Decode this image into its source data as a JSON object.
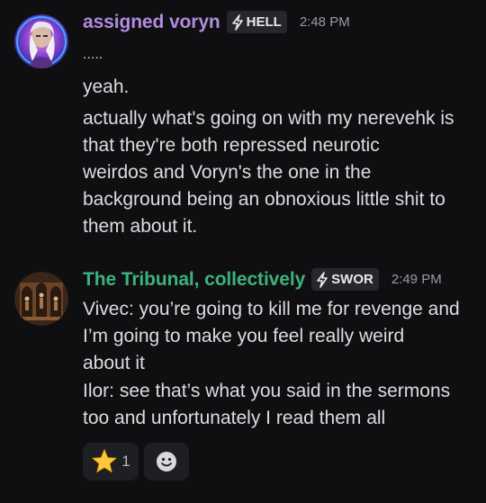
{
  "colors": {
    "background": "#0f0f11",
    "message_text": "#dcdde0",
    "timestamp": "#9a9ca3",
    "tag_background": "#26272c",
    "reaction_background": "#1e1f23"
  },
  "messages": [
    {
      "username": "assigned voryn",
      "username_color": "#b08be0",
      "tag": {
        "icon": "lightning-icon",
        "label": "HELL"
      },
      "timestamp": "2:48 PM",
      "lines": [
        ".....",
        "yeah.",
        "actually what's going on with my nerevehk is",
        "that they're both repressed neurotic",
        "weirdos and Voryn's the one in the",
        "background being an obnoxious little shit to",
        "them about it."
      ]
    },
    {
      "username": "The Tribunal, collectively",
      "username_color": "#3bb27d",
      "tag": {
        "icon": "lightning-icon",
        "label": "SWOR"
      },
      "timestamp": "2:49 PM",
      "lines": [
        "Vivec: you’re going to kill me for revenge and",
        "I’m going to make you feel really weird",
        "about it",
        "Ilor: see that’s what you said in the sermons",
        "too and unfortunately I read them all"
      ],
      "reactions": [
        {
          "emoji": "star-icon",
          "count": "1"
        },
        {
          "emoji": "add-reaction-icon"
        }
      ]
    }
  ]
}
